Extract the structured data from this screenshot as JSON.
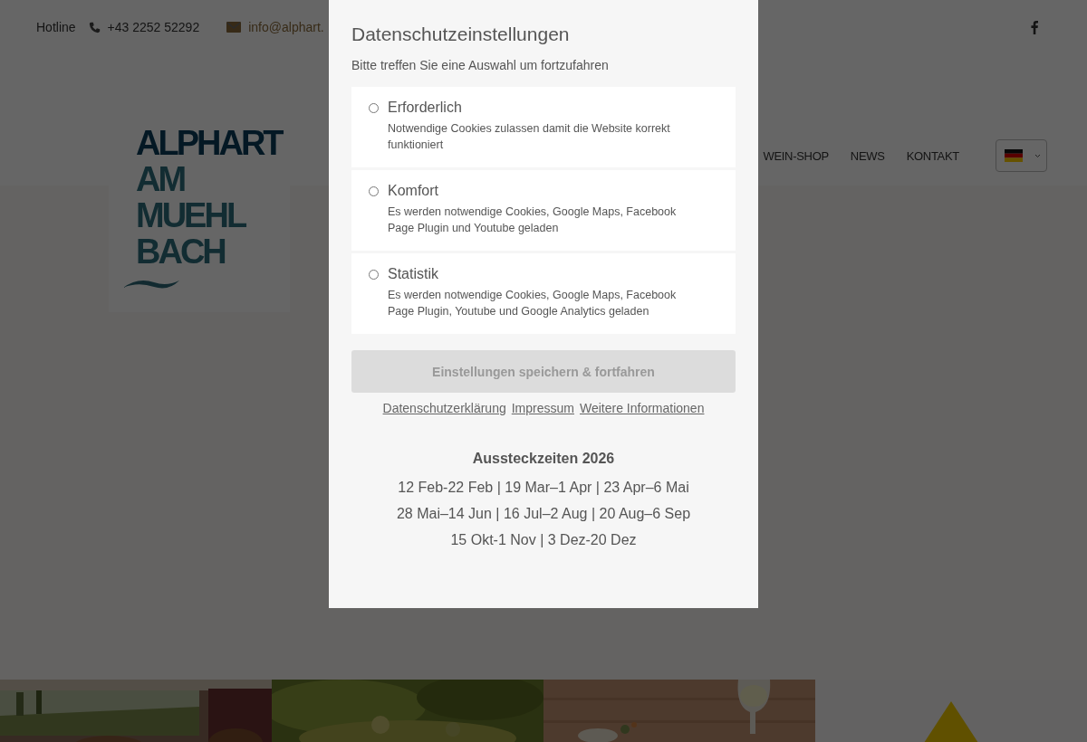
{
  "top_bar": {
    "hotline_label": "Hotline",
    "phone": "+43 2252 52292",
    "email": "info@alphart."
  },
  "logo": {
    "lines": [
      "ALPHART",
      "AM",
      "MUEHL",
      "BACH"
    ]
  },
  "nav": {
    "items": [
      "WEIN-SHOP",
      "NEWS",
      "KONTAKT"
    ]
  },
  "tiles": [
    {
      "kind": "picture"
    },
    {
      "kind": "picture"
    },
    {
      "kind": "picture"
    },
    {
      "kind": "graphic"
    }
  ],
  "consent_dialog": {
    "title": "Datenschutzeinstellungen",
    "subtitle": "Bitte treffen Sie eine Auswahl um fortzufahren",
    "options": [
      {
        "label": "Erforderlich",
        "description": "Notwendige Cookies zulassen damit die Website korrekt funktioniert",
        "selected": false
      },
      {
        "label": "Komfort",
        "description": "Es werden notwendige Cookies, Google Maps, Facebook Page Plugin und Youtube geladen",
        "selected": false
      },
      {
        "label": "Statistik",
        "description": "Es werden notwendige Cookies, Google Maps, Facebook Page Plugin, Youtube und Google Analytics geladen",
        "selected": false
      }
    ],
    "save_button": {
      "label": "Einstellungen speichern & fortfahren",
      "disabled": true
    },
    "links": [
      "Datenschutzerklärung",
      "Impressum",
      "Weitere Informationen"
    ],
    "schedule": {
      "title": "Aussteckzeiten 2026",
      "lines": [
        "12 Feb-22 Feb | 19 Mar–1 Apr | 23 Apr–6 Mai",
        "28 Mai–14 Jun | 16 Jul–2 Aug | 20 Aug–6 Sep",
        "15 Okt-1 Nov | 3 Dez-20 Dez"
      ]
    }
  }
}
